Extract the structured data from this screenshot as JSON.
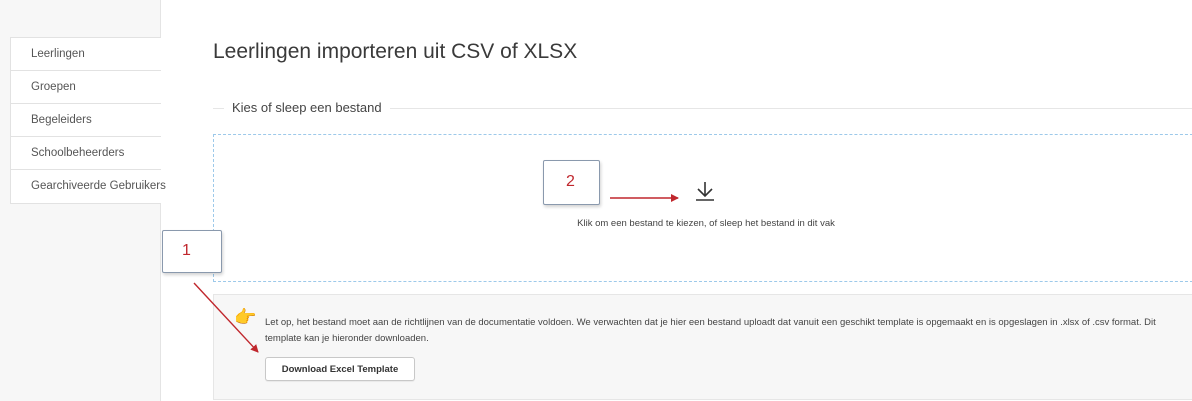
{
  "sidebar": {
    "items": [
      {
        "label": "Leerlingen"
      },
      {
        "label": "Groepen"
      },
      {
        "label": "Begeleiders"
      },
      {
        "label": "Schoolbeheerders"
      },
      {
        "label": "Gearchiveerde Gebruikers"
      }
    ]
  },
  "main": {
    "title": "Leerlingen importeren uit CSV of XLSX",
    "fieldset_legend": "Kies of sleep een bestand",
    "dropzone_text": "Klik om een bestand te kiezen, of sleep het bestand in dit vak",
    "notice_text": "Let op, het bestand moet aan de richtlijnen van de documentatie voldoen. We verwachten dat je hier een bestand uploadt dat vanuit een geschikt template is opgemaakt en is opgeslagen in .xlsx of .csv format. Dit template kan je hieronder downloaden.",
    "download_button_label": "Download Excel Template"
  },
  "annotations": {
    "callout_1": "1",
    "callout_2": "2"
  },
  "icons": {
    "drop": "download-arrow-icon",
    "notice": "pointing-hand-icon"
  },
  "colors": {
    "callout_text": "#c0272d",
    "arrow": "#c0272d",
    "dropzone_border": "#9dc9ea",
    "hand": "#f2a81d"
  }
}
